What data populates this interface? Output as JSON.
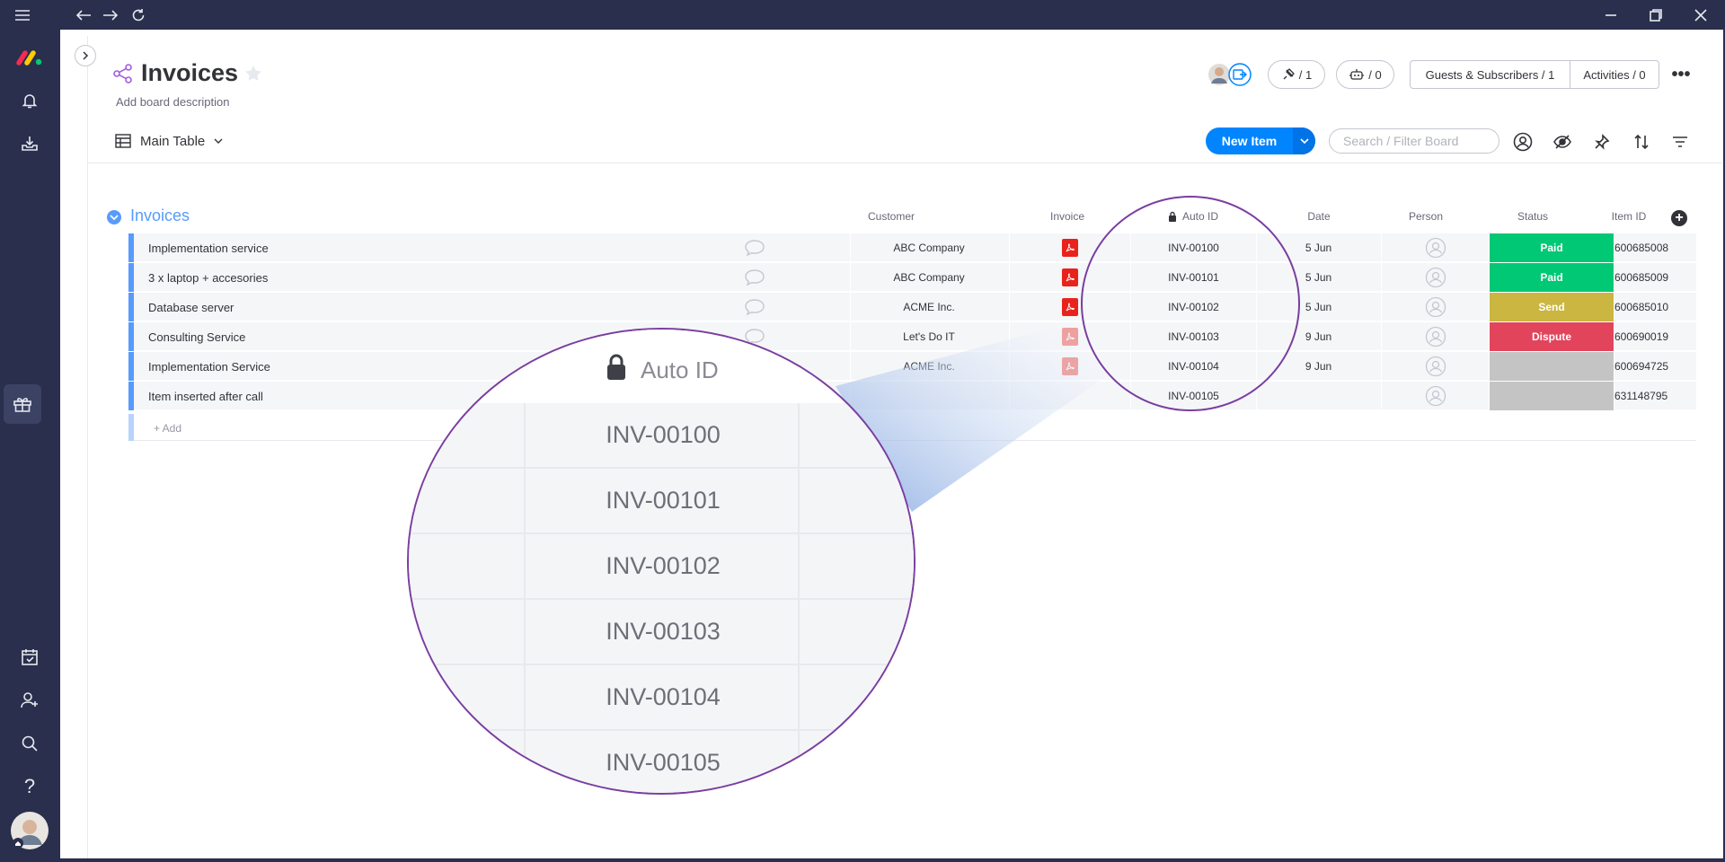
{
  "window": {
    "menu_icon": "hamburger-icon",
    "nav_icons": [
      "back-arrow-icon",
      "forward-arrow-icon",
      "reload-icon"
    ],
    "controls": [
      "minimize-icon",
      "restore-icon",
      "close-icon"
    ]
  },
  "left_nav": {
    "top_icons": [
      "monday-logo",
      "bell-icon",
      "inbox-icon",
      "gift-icon"
    ],
    "bottom_icons": [
      "calendar-check-icon",
      "invite-user-icon",
      "search-icon",
      "help-icon",
      "user-avatar"
    ],
    "help_label": "?"
  },
  "header": {
    "title": "Invoices",
    "description": "Add board description",
    "view_tab": "Main Table",
    "integrations_count": "/ 1",
    "automations_count": "/ 0",
    "guests_label": "Guests & Subscribers / 1",
    "activities_label": "Activities / 0",
    "more_label": "•••"
  },
  "toolbar": {
    "new_item_label": "New Item",
    "search_placeholder": "Search / Filter Board"
  },
  "group": {
    "title": "Invoices",
    "columns": {
      "customer": "Customer",
      "invoice": "Invoice",
      "auto_id": "Auto ID",
      "date": "Date",
      "person": "Person",
      "status": "Status",
      "item_id": "Item ID"
    },
    "add_column_label": "+",
    "rows": [
      {
        "name": "Implementation service",
        "customer": "ABC Company",
        "has_invoice": true,
        "auto_id": "INV-00100",
        "date": "5 Jun",
        "status": "Paid",
        "status_color": "#00c875",
        "item_id": "600685008"
      },
      {
        "name": "3 x laptop + accesories",
        "customer": "ABC Company",
        "has_invoice": true,
        "auto_id": "INV-00101",
        "date": "5 Jun",
        "status": "Paid",
        "status_color": "#00c875",
        "item_id": "600685009"
      },
      {
        "name": "Database server",
        "customer": "ACME Inc.",
        "has_invoice": true,
        "auto_id": "INV-00102",
        "date": "5 Jun",
        "status": "Send",
        "status_color": "#cab641",
        "item_id": "600685010"
      },
      {
        "name": "Consulting Service",
        "customer": "Let's Do IT",
        "has_invoice": true,
        "auto_id": "INV-00103",
        "date": "9 Jun",
        "status": "Dispute",
        "status_color": "#e2445c",
        "item_id": "600690019"
      },
      {
        "name": "Implementation Service",
        "customer": "ACME Inc.",
        "has_invoice": true,
        "auto_id": "INV-00104",
        "date": "9 Jun",
        "status": "",
        "status_color": "#c4c4c4",
        "item_id": "600694725"
      },
      {
        "name": "Item inserted after call",
        "customer": "",
        "has_invoice": false,
        "auto_id": "INV-00105",
        "date": "",
        "status": "",
        "status_color": "#c4c4c4",
        "item_id": "631148795"
      }
    ],
    "add_row_label": "+ Add"
  },
  "zoom": {
    "header_label": "Auto ID",
    "values": [
      "INV-00100",
      "INV-00101",
      "INV-00102",
      "INV-00103",
      "INV-00104",
      "INV-00105"
    ]
  },
  "colors": {
    "nav_bg": "#292f4c",
    "accent": "#0085ff",
    "group_blue": "#579bfc",
    "callout": "#7a3ea0",
    "pdf_red": "#e8231c"
  }
}
